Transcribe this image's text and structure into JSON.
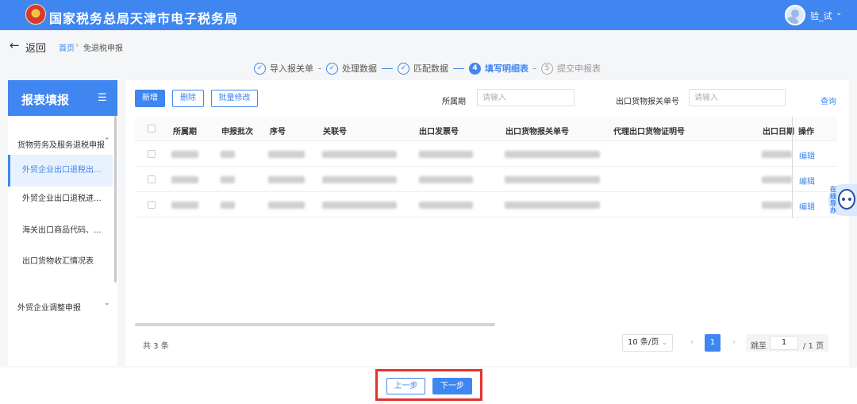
{
  "header": {
    "title": "国家税务总局天津市电子税务局",
    "user_name": "验_试",
    "colors": {
      "primary": "#3f86f0",
      "highlight": "#e5322d"
    }
  },
  "breadcrumb": {
    "back_label": "返回",
    "home": "首页",
    "separator": "›",
    "current": "免退税申报"
  },
  "steps": [
    {
      "icon": "check-icon",
      "mark": "✓",
      "label": "导入报关单",
      "state": "done"
    },
    {
      "icon": "check-icon",
      "mark": "✓",
      "label": "处理数据",
      "state": "done"
    },
    {
      "icon": "check-icon",
      "mark": "✓",
      "label": "匹配数据",
      "state": "done"
    },
    {
      "icon": "step-number-icon",
      "mark": "4",
      "label": "填写明细表",
      "state": "active"
    },
    {
      "icon": "step-number-icon",
      "mark": "5",
      "label": "提交申报表",
      "state": "todo"
    }
  ],
  "sidebar": {
    "title": "报表填报",
    "menu_icon": "☰",
    "group1": "货物劳务及服务退税申报",
    "group1_caret": "⌃",
    "items": [
      {
        "label": "外贸企业出口退税出...",
        "active": true
      },
      {
        "label": "外贸企业出口退税进...",
        "active": false
      },
      {
        "label": "海关出口商品代码、...",
        "active": false
      },
      {
        "label": "出口货物收汇情况表",
        "active": false
      }
    ],
    "group2": "外贸企业调整申报",
    "group2_caret": "⌄"
  },
  "toolbar": {
    "add_label": "新增",
    "delete_label": "删除",
    "batch_edit_label": "批量修改",
    "period_label": "所属期",
    "period_placeholder": "请输入",
    "customs_label": "出口货物报关单号",
    "customs_placeholder": "请输入",
    "query_label": "查询"
  },
  "table": {
    "columns": [
      "所属期",
      "申报批次",
      "序号",
      "关联号",
      "出口发票号",
      "出口货物报关单号",
      "代理出口货物证明号",
      "出口日期",
      "操作"
    ],
    "rows": [
      {
        "action": "编辑"
      },
      {
        "action": "编辑"
      },
      {
        "action": "编辑"
      }
    ]
  },
  "pagination": {
    "total": "共 3 条",
    "page_size": "10 条/页",
    "prev": "‹",
    "current_page": "1",
    "next": "›",
    "jump_prefix": "跳至",
    "jump_value": "1",
    "jump_suffix": "/ 1 页"
  },
  "assistant": {
    "label": "在线导办"
  },
  "footer": {
    "prev_label": "上一步",
    "next_label": "下一步"
  }
}
